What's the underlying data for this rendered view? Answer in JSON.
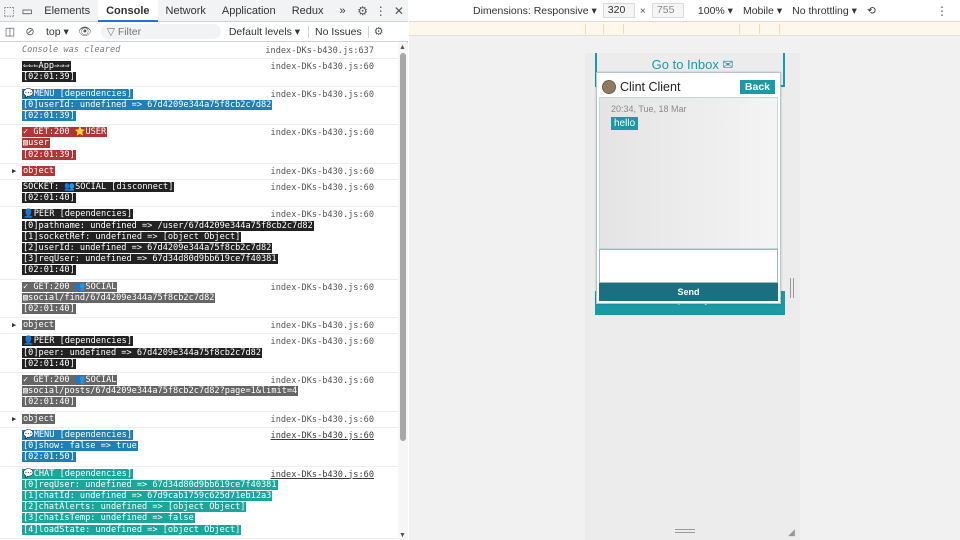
{
  "devtools": {
    "tabs": [
      {
        "label": "Elements"
      },
      {
        "label": "Console"
      },
      {
        "label": "Network"
      },
      {
        "label": "Application"
      },
      {
        "label": "Redux"
      }
    ],
    "tabs_more": "»",
    "toolbar": {
      "context": "top",
      "filter_placeholder": "Filter",
      "levels": "Default levels",
      "issues": "No Issues"
    }
  },
  "console": {
    "cleared": "Console was cleared",
    "cleared_src": "index-DKs-b430.js:637",
    "src": "index-DKs-b430.js:60",
    "entries": {
      "e1": [
        "⇐⇐⇐App⇒⇒⇒",
        "[02:01:39]"
      ],
      "e2": [
        "💬MENU [dependencies]",
        "[0]userId: undefined => 67d4209e344a75f8cb2c7d82",
        "[02:01:39]"
      ],
      "e3": [
        "✓ GET:200 ⭐USER",
        "▧user",
        "[02:01:39]"
      ],
      "e4": [
        "object"
      ],
      "e5": [
        "SOCKET: 👥SOCIAL [disconnect]",
        "[02:01:40]"
      ],
      "e6": [
        "👤PEER [dependencies]",
        "[0]pathname: undefined => /user/67d4209e344a75f8cb2c7d82",
        "[1]socketRef: undefined => [object Object]",
        "[2]userId: undefined => 67d4209e344a75f8cb2c7d82",
        "[3]reqUser: undefined => 67d34d80d9bb619ce7f40381",
        "[02:01:40]"
      ],
      "e7": [
        "✓ GET:200 👥SOCIAL",
        "▧social/find/67d4209e344a75f8cb2c7d82",
        "[02:01:40]"
      ],
      "e8": [
        "object"
      ],
      "e9": [
        "👤PEER [dependencies]",
        "[0]peer: undefined => 67d4209e344a75f8cb2c7d82",
        "[02:01:40]"
      ],
      "e10": [
        "✓ GET:200 👥SOCIAL",
        "▧social/posts/67d4209e344a75f8cb2c7d82?page=1&limit=4",
        "[02:01:40]"
      ],
      "e11": [
        "object"
      ],
      "e12": [
        "💬MENU [dependencies]",
        "[0]show: false => true",
        "[02:01:50]"
      ],
      "e13": [
        "💬CHAT [dependencies]",
        "[0]reqUser: undefined => 67d34d80d9bb619ce7f40381",
        "[1]chatId: undefined => 67d9cab1759c625d71eb12a3",
        "[2]chatAlerts: undefined => [object Object]",
        "[3]chatIsTemp: undefined => false",
        "[4]loadState: undefined => [object Object]"
      ]
    }
  },
  "device_toolbar": {
    "dimensions": "Dimensions: Responsive",
    "width": "320",
    "height": "755",
    "zoom": "100%",
    "device": "Mobile",
    "throttling": "No throttling"
  },
  "page": {
    "inbox_link": "Go to Inbox",
    "no_posts": "No posts yet",
    "chat": {
      "name": "Clint Client",
      "back": "Back",
      "time": "20:34, Tue, 18 Mar",
      "message": "hello",
      "send": "Send"
    }
  },
  "colors": {
    "accent": "#1b9aa5",
    "send": "#1a6f80"
  }
}
